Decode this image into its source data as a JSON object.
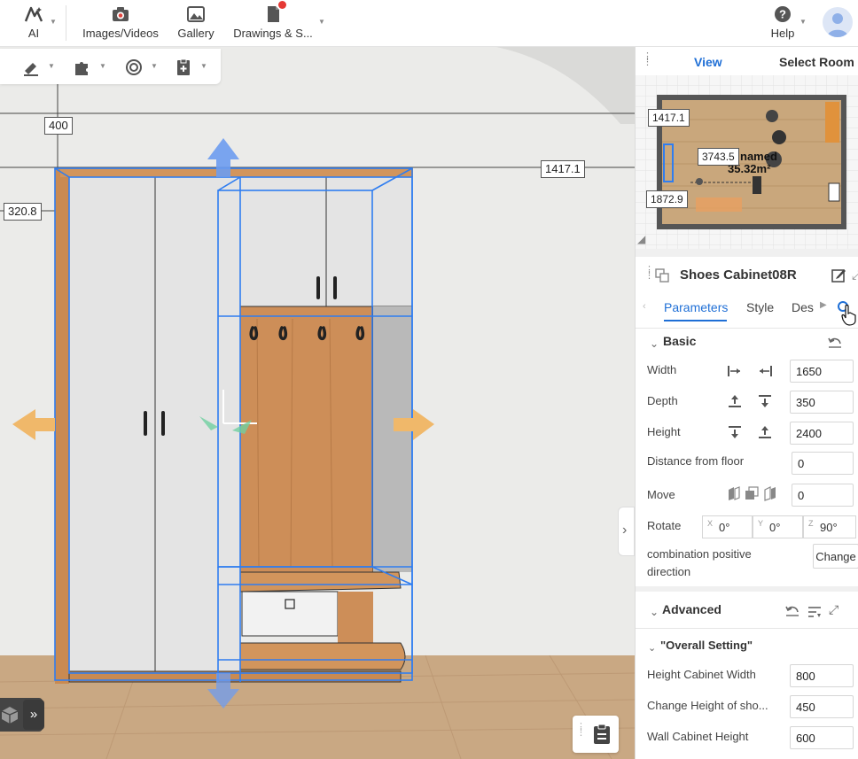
{
  "topbar": {
    "ai_label": "AI",
    "images_label": "Images/Videos",
    "gallery_label": "Gallery",
    "drawings_label": "Drawings & S...",
    "help_label": "Help"
  },
  "dimensions": {
    "top": "400",
    "right": "1417.1",
    "left": "320.8"
  },
  "view_panel": {
    "view_tab": "View",
    "select_room_tab": "Select Room",
    "minimap": {
      "dim_top": "1417.1",
      "dim_mid": "3743.5",
      "dim_bottom": "1872.9",
      "room_name": "named",
      "room_area": "35.32m²"
    }
  },
  "properties": {
    "title": "Shoes Cabinet08R",
    "tabs": [
      "Parameters",
      "Style",
      "Des"
    ],
    "basic": {
      "title": "Basic",
      "width_label": "Width",
      "width_value": "1650",
      "depth_label": "Depth",
      "depth_value": "350",
      "height_label": "Height",
      "height_value": "2400",
      "floor_label": "Distance from floor",
      "floor_value": "0",
      "move_label": "Move",
      "move_value": "0",
      "rotate_label": "Rotate",
      "rotate_x": "0°",
      "rotate_y": "0°",
      "rotate_z": "90°",
      "axis_x": "X",
      "axis_y": "Y",
      "axis_z": "Z",
      "combo_label_1": "combination positive",
      "combo_label_2": "direction",
      "change_button": "Change"
    },
    "advanced": {
      "title": "Advanced",
      "group_title": "\"Overall Setting\"",
      "rows": [
        {
          "label": "Height Cabinet Width",
          "value": "800"
        },
        {
          "label": "Change Height of sho...",
          "value": "450"
        },
        {
          "label": "Wall Cabinet Height",
          "value": "600"
        }
      ]
    }
  },
  "colors": {
    "accent": "#1f6fd6",
    "wood": "#d2955c",
    "selection": "#2f7df0",
    "arrow_orange": "#f0b86a"
  }
}
